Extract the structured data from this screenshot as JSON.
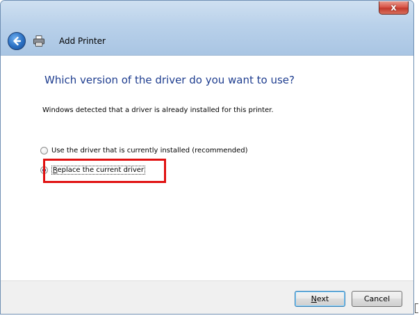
{
  "window": {
    "close_symbol": "x",
    "title": "Add Printer",
    "icons": {
      "back": "back-arrow-icon",
      "app": "printer-icon"
    }
  },
  "content": {
    "heading": "Which version of the driver do you want to use?",
    "description": "Windows detected that a driver is already installed for this printer.",
    "options": [
      {
        "label": "Use the driver that is currently installed (recommended)",
        "checked": false
      },
      {
        "label_accel": "R",
        "label_rest": "eplace the current driver",
        "checked": true
      }
    ]
  },
  "footer": {
    "next_accel": "N",
    "next_rest": "ext",
    "cancel_label": "Cancel"
  },
  "colors": {
    "heading": "#1e3d8f",
    "highlight": "#e01010"
  }
}
